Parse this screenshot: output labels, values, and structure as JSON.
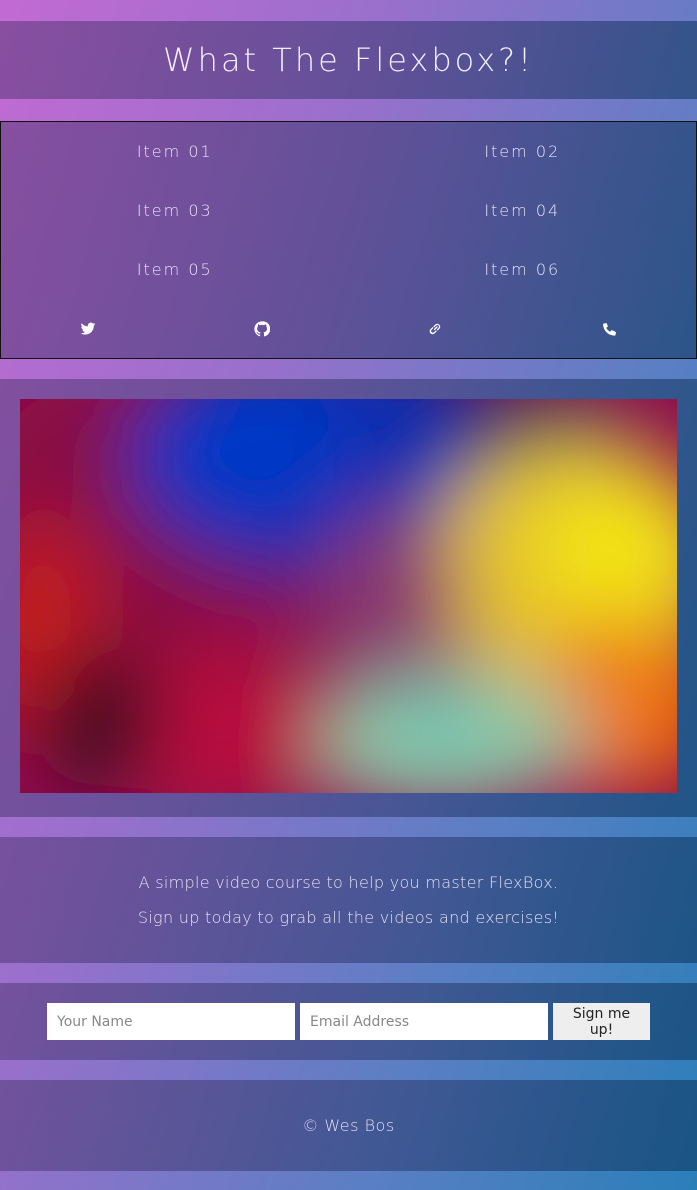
{
  "header": {
    "title": "What The Flexbox?!"
  },
  "nav": {
    "items": [
      "Item 01",
      "Item 02",
      "Item 03",
      "Item 04",
      "Item 05",
      "Item 06"
    ],
    "social": [
      "twitter-icon",
      "github-icon",
      "link-icon",
      "phone-icon"
    ]
  },
  "details": {
    "line1": "A simple video course to help you master FlexBox.",
    "line2": "Sign up today to grab all the videos and exercises!"
  },
  "signup": {
    "name_placeholder": "Your Name",
    "email_placeholder": "Email Address",
    "button_label": "Sign me up!"
  },
  "footer": {
    "text": "© Wes Bos"
  }
}
